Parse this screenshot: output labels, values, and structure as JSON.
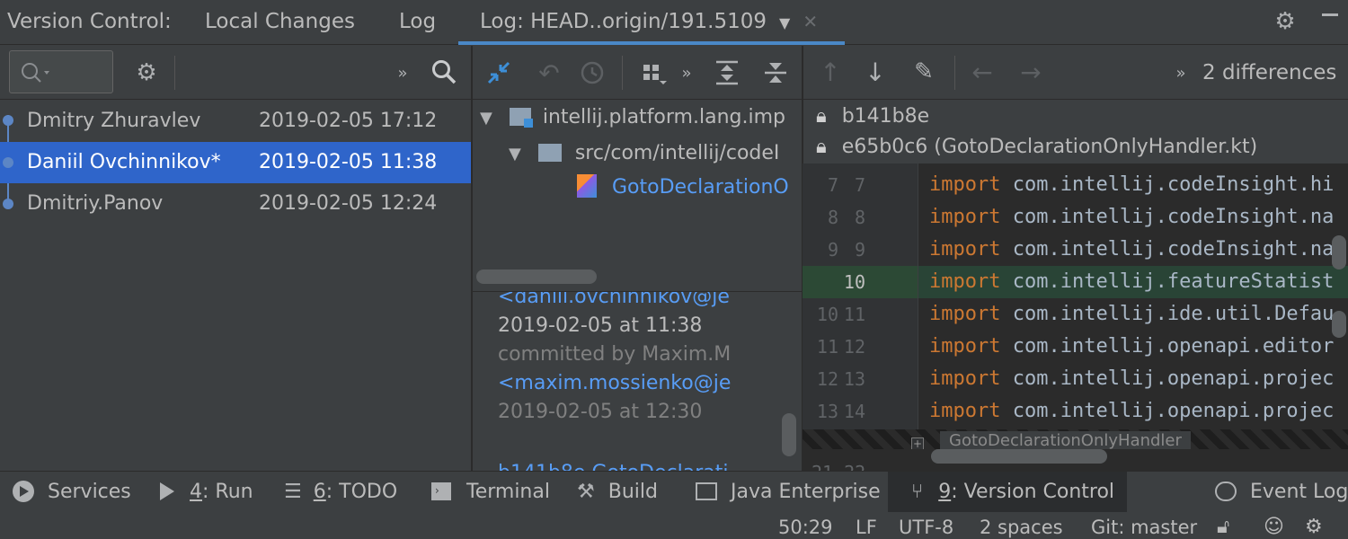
{
  "topbar": {
    "label": "Version Control:",
    "tabs": [
      {
        "label": "Local Changes"
      },
      {
        "label": "Log"
      },
      {
        "label": "Log: HEAD..origin/191.5109"
      }
    ]
  },
  "commits": [
    {
      "author": "Dmitry Zhuravlev",
      "date": "2019-02-05 17:12"
    },
    {
      "author": "Daniil Ovchinnikov*",
      "date": "2019-02-05 11:38"
    },
    {
      "author": "Dmitriy.Panov",
      "date": "2019-02-05 12:24"
    }
  ],
  "tree": {
    "module": "intellij.platform.lang.imp",
    "folder": "src/com/intellij/codeI",
    "file": "GotoDeclarationO"
  },
  "details": {
    "email1": "<daniil.ovchinnikov@je",
    "date1": "2019-02-05 at 11:38",
    "committed_by": "committed by Maxim.M",
    "email2": "<maxim.mossienko@je",
    "date2": "2019-02-05 at 12:30",
    "cut_line": "b141b8e  GotoDeclarati"
  },
  "diff": {
    "differences": "2 differences",
    "rev1": "b141b8e",
    "rev2": "e65b0c6 (GotoDeclarationOnlyHandler.kt)",
    "lines": [
      {
        "l": "7",
        "r": "7",
        "kw": "import",
        "code": " com.intellij.codeInsight.hi",
        "inserted": false
      },
      {
        "l": "8",
        "r": "8",
        "kw": "import",
        "code": " com.intellij.codeInsight.na",
        "inserted": false
      },
      {
        "l": "9",
        "r": "9",
        "kw": "import",
        "code": " com.intellij.codeInsight.na",
        "inserted": false
      },
      {
        "l": "",
        "r": "10",
        "kw": "import",
        "code": " com.intellij.featureStatist",
        "inserted": true
      },
      {
        "l": "10",
        "r": "11",
        "kw": "import",
        "code": " com.intellij.ide.util.Defau",
        "inserted": false
      },
      {
        "l": "11",
        "r": "12",
        "kw": "import",
        "code": " com.intellij.openapi.editor",
        "inserted": false
      },
      {
        "l": "12",
        "r": "13",
        "kw": "import",
        "code": " com.intellij.openapi.projec",
        "inserted": false
      },
      {
        "l": "13",
        "r": "14",
        "kw": "import",
        "code": " com.intellij.openapi.projec",
        "inserted": false
      }
    ],
    "breadcrumb": "GotoDeclarationOnlyHandler",
    "next_lines": "21 22"
  },
  "toolwindows": [
    {
      "key": "",
      "label": "Services"
    },
    {
      "key": "4",
      "label": ": Run"
    },
    {
      "key": "6",
      "label": ": TODO"
    },
    {
      "key": "",
      "label": "Terminal"
    },
    {
      "key": "",
      "label": "Build"
    },
    {
      "key": "",
      "label": "Java Enterprise"
    },
    {
      "key": "9",
      "label": ": Version Control"
    },
    {
      "key": "",
      "label": "Event Log"
    }
  ],
  "status": {
    "position": "50:29",
    "line_sep": "LF",
    "encoding": "UTF-8",
    "indent": "2 spaces",
    "git": "Git: master"
  },
  "colors": {
    "accent": "#2f65ca",
    "link": "#589df6",
    "inserted": "#294436"
  }
}
